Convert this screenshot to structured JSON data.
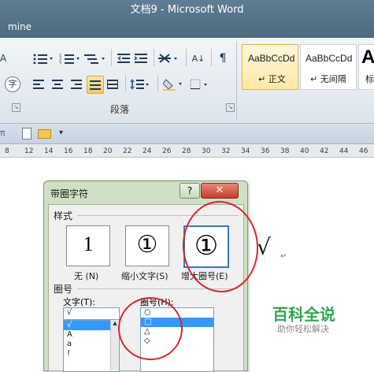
{
  "window": {
    "title": "文档9 - Microsoft Word",
    "tab": "mine"
  },
  "ribbon": {
    "paragraph_group_label": "段落",
    "styles": [
      {
        "sample": "AaBbCcDd",
        "name": "↵ 正文",
        "selected": true
      },
      {
        "sample": "AaBbCcDd",
        "name": "↵ 无间隔",
        "selected": false
      },
      {
        "sample": "A",
        "name": "标",
        "selected": false
      }
    ],
    "icons": {
      "sort": "A↓",
      "pilcrow": "¶",
      "char_circle": "字"
    }
  },
  "ruler": {
    "ticks": [
      "8",
      "12",
      "14",
      "16",
      "18",
      "20",
      "22",
      "24",
      "26",
      "28",
      "30",
      "32",
      "34",
      "36",
      "38",
      "40",
      "42",
      "44",
      "46"
    ]
  },
  "document": {
    "paragraph_mark": "↵",
    "check_mark": "√"
  },
  "dialog": {
    "title": "带圈字符",
    "help": "?",
    "close": "✕",
    "style_section": "样式",
    "style_options": [
      {
        "glyph": "1",
        "label": "无 (N)",
        "selected": false
      },
      {
        "glyph": "①",
        "label": "缩小文字(S)",
        "selected": false
      },
      {
        "glyph": "①",
        "label": "增大圈号(E)",
        "selected": true
      }
    ],
    "circle_section": "圈号",
    "text_label": "文字(T):",
    "text_value": "√",
    "text_list": [
      "√",
      "A",
      "a",
      "!"
    ],
    "circle_label": "圈号(H):",
    "circle_list": [
      "○",
      "□",
      "△",
      "◇"
    ],
    "circle_selected_index": 1
  },
  "watermark": {
    "title": "百科全说",
    "subtitle": "助你轻松解决"
  },
  "colors": {
    "accent_red": "#d9262b",
    "watermark_green": "#2fa84f",
    "selection_blue": "#3399ff"
  }
}
